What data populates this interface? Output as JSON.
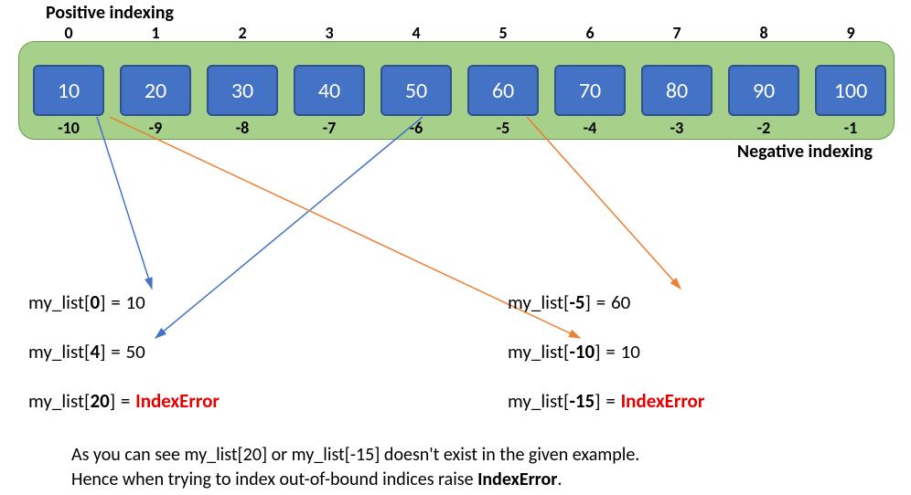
{
  "titles": {
    "positive": "Positive indexing",
    "negative": "Negative indexing"
  },
  "cells": [
    {
      "pos": "0",
      "val": "10",
      "neg": "-10"
    },
    {
      "pos": "1",
      "val": "20",
      "neg": "-9"
    },
    {
      "pos": "2",
      "val": "30",
      "neg": "-8"
    },
    {
      "pos": "3",
      "val": "40",
      "neg": "-7"
    },
    {
      "pos": "4",
      "val": "50",
      "neg": "-6"
    },
    {
      "pos": "5",
      "val": "60",
      "neg": "-5"
    },
    {
      "pos": "6",
      "val": "70",
      "neg": "-4"
    },
    {
      "pos": "7",
      "val": "80",
      "neg": "-3"
    },
    {
      "pos": "8",
      "val": "90",
      "neg": "-2"
    },
    {
      "pos": "9",
      "val": "100",
      "neg": "-1"
    }
  ],
  "examples": {
    "left": [
      {
        "prefix": "my_list[",
        "idx": "0",
        "suffix": "] = ",
        "val": "10",
        "err": null
      },
      {
        "prefix": "my_list[",
        "idx": "4",
        "suffix": "] = ",
        "val": "50",
        "err": null
      },
      {
        "prefix": "my_list[",
        "idx": "20",
        "suffix": "] =  ",
        "val": null,
        "err": "IndexError"
      }
    ],
    "right": [
      {
        "prefix": "my_list[",
        "idx": "-5",
        "suffix": "] = ",
        "val": "60",
        "err": null
      },
      {
        "prefix": "my_list[",
        "idx": "-10",
        "suffix": "] = ",
        "val": "10",
        "err": null
      },
      {
        "prefix": "my_list[",
        "idx": "-15",
        "suffix": "] = ",
        "val": null,
        "err": "IndexError"
      }
    ]
  },
  "caption": {
    "line1a": "As you can see my_list[20] or my_list[-15] doesn't exist in the given example.",
    "line2a": "Hence when trying to index out-of-bound indices raise ",
    "line2b": "IndexError",
    "line2c": "."
  },
  "layout": {
    "cell_start": 36,
    "cell_step": 95
  },
  "arrows": {
    "blue": "#4472c4",
    "orange": "#ed7d31"
  }
}
